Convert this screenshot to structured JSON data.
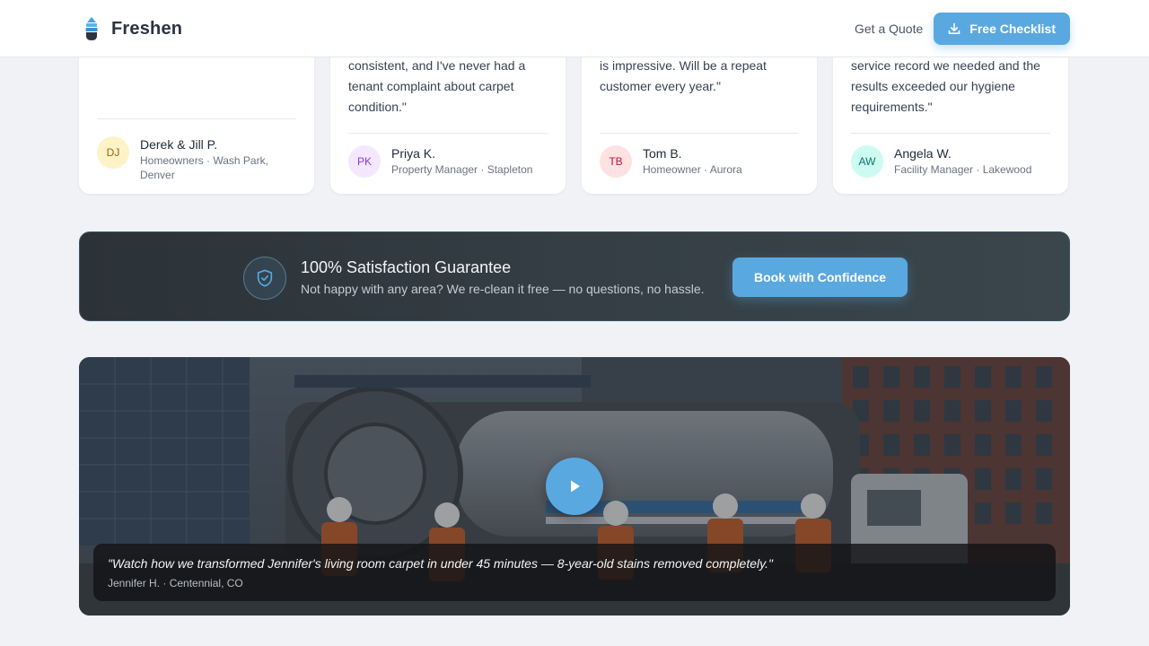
{
  "header": {
    "brand": "Freshen",
    "quote_link": "Get a Quote",
    "checklist_button": "Free Checklist"
  },
  "testimonials": [
    {
      "quote": "",
      "name": "Derek & Jill P.",
      "role": "Homeowners · Wash Park, Denver",
      "initials": "DJ",
      "avatar_bg": "#fdf3c7",
      "avatar_color": "#a16207"
    },
    {
      "quote": "consistent, and I've never had a tenant complaint about carpet condition.\"",
      "name": "Priya K.",
      "role": "Property Manager · Stapleton",
      "initials": "PK",
      "avatar_bg": "#f3e8ff",
      "avatar_color": "#9333ea"
    },
    {
      "quote": "is impressive. Will be a repeat customer every year.\"",
      "name": "Tom B.",
      "role": "Homeowner · Aurora",
      "initials": "TB",
      "avatar_bg": "#fee2e2",
      "avatar_color": "#be123c"
    },
    {
      "quote": "service record we needed and the results exceeded our hygiene requirements.\"",
      "name": "Angela W.",
      "role": "Facility Manager · Lakewood",
      "initials": "AW",
      "avatar_bg": "#ccfbf1",
      "avatar_color": "#0f766e"
    }
  ],
  "guarantee": {
    "title": "100% Satisfaction Guarantee",
    "subtitle": "Not happy with any area? We re-clean it free — no questions, no hassle.",
    "button": "Book with Confidence"
  },
  "video": {
    "caption_quote": "\"Watch how we transformed Jennifer's living room carpet in under 45 minutes — 8-year-old stains removed completely.\"",
    "caption_author": "Jennifer H. · Centennial, CO"
  },
  "colors": {
    "accent": "#5aa8e0",
    "page_bg": "#f0f2f5"
  },
  "icons": {
    "logo": "droplet-stack-icon",
    "download": "download-icon",
    "shield": "shield-check-icon",
    "play": "play-icon"
  }
}
